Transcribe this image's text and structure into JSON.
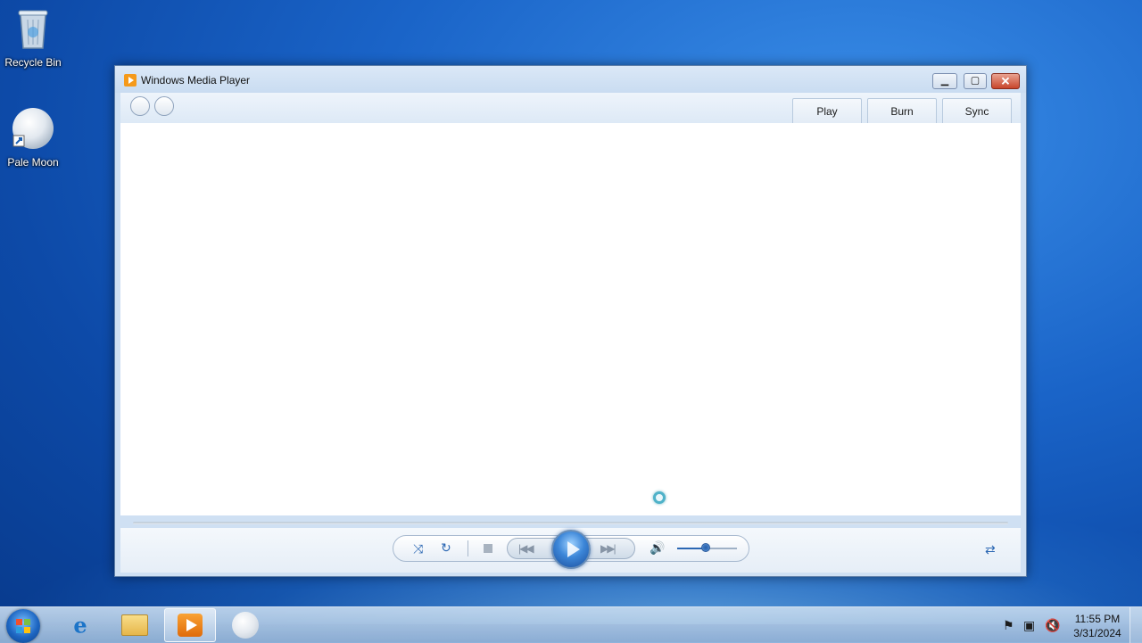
{
  "desktop": {
    "icons": [
      {
        "label": "Recycle Bin",
        "icon": "recycle-bin-icon"
      },
      {
        "label": "Pale Moon",
        "icon": "pale-moon-icon"
      }
    ]
  },
  "window": {
    "title": "Windows Media Player",
    "title_icon": "windows-media-player-icon",
    "controls": {
      "minimize": "▁",
      "maximize": "▢",
      "close": "✕"
    },
    "nav": {
      "back": "back-icon",
      "forward": "forward-icon"
    },
    "tabs": [
      {
        "label": "Play"
      },
      {
        "label": "Burn"
      },
      {
        "label": "Sync"
      }
    ],
    "content_state": "loading",
    "player": {
      "shuffle_glyph": "⤨",
      "repeat_glyph": "↻",
      "previous_glyph": "|◀◀",
      "next_glyph": "▶▶|",
      "volume_glyph": "🔊",
      "volume_level": 0.48,
      "switch_view_glyph": "⇄"
    }
  },
  "taskbar": {
    "pinned": [
      {
        "name": "internet-explorer",
        "icon": "internet-explorer-icon"
      },
      {
        "name": "windows-explorer",
        "icon": "folder-icon"
      },
      {
        "name": "windows-media-player",
        "icon": "windows-media-player-icon",
        "active": true
      },
      {
        "name": "pale-moon",
        "icon": "pale-moon-icon"
      }
    ],
    "tray": {
      "flag_glyph": "⚑",
      "network_glyph": "▣",
      "volume_glyph": "🔇"
    },
    "clock": {
      "time": "11:55 PM",
      "date": "3/31/2024"
    }
  },
  "colors": {
    "accent": "#2b67b3",
    "close_button": "#c8452b",
    "desktop_bg": "#1a64c8"
  }
}
